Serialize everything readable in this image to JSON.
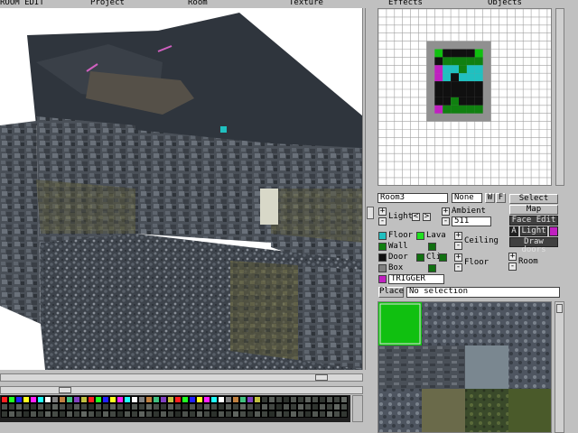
{
  "menu": {
    "room_edit": "ROOM EDIT",
    "project": "Project",
    "room": "Room",
    "texture": "Texture",
    "effects": "Effects",
    "objects": "Objects"
  },
  "room_panel": {
    "room_name": "Room3",
    "flip_value": "None",
    "w_button": "W",
    "f_button": "F",
    "light_label": "Light",
    "ambient_label": "Ambient",
    "ambient_value": "511",
    "ceiling_label": "Ceiling",
    "floor_label": "Floor",
    "room_label": "Room",
    "plus": "+",
    "minus": "-",
    "left_arrow": "<",
    "right_arrow": ">"
  },
  "mode_buttons": {
    "select": "Select",
    "map": "Map",
    "face_edit": "Face Edit",
    "a": "A",
    "light": "Light",
    "draw_doors": "Draw doors"
  },
  "legend": {
    "floor": "Floor",
    "lava": "Lava",
    "wall": "Wall",
    "door": "Door",
    "cli": "Cli",
    "box": "Box",
    "trigger": "TRIGGER"
  },
  "status": {
    "place_button": "Place",
    "selection_text": "No selection"
  },
  "colors": {
    "floor": "#20c0c0",
    "lava": "#20e020",
    "wall": "#108010",
    "door": "#101010",
    "box": "#808080",
    "trigger": "#c020c0",
    "cli": "#107010",
    "selected_texture": "#10c010"
  },
  "scrollbars": {
    "horizontal_1_position": 0.9,
    "horizontal_2_position": 0.18
  }
}
